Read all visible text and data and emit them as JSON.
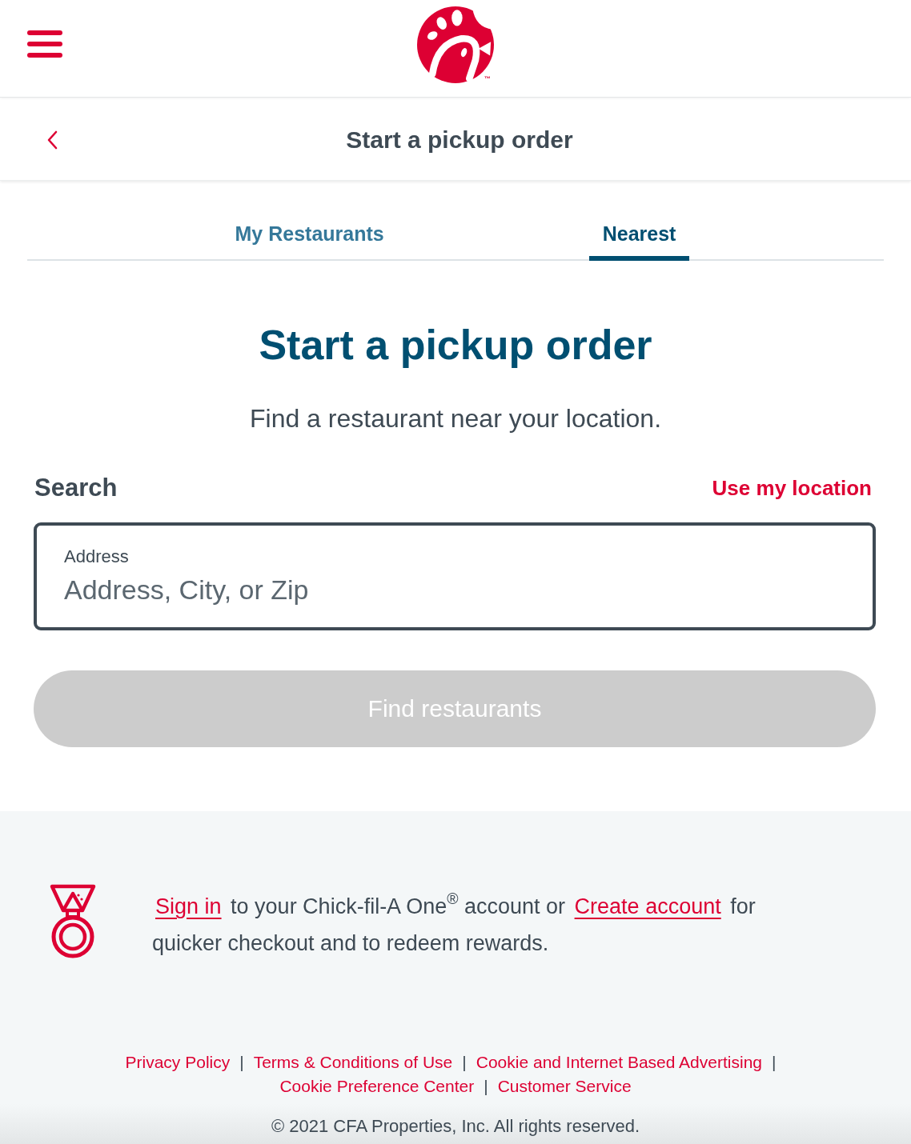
{
  "header": {
    "logo_mark": "™"
  },
  "subheader": {
    "title": "Start a pickup order"
  },
  "tabs": [
    {
      "label": "My Restaurants",
      "selected": false
    },
    {
      "label": "Nearest",
      "selected": true
    }
  ],
  "main": {
    "heading": "Start a pickup order",
    "subtitle": "Find a restaurant near your location.",
    "search_label": "Search",
    "location_link": "Use my location",
    "address_field": {
      "label": "Address",
      "placeholder": "Address, City, or Zip"
    },
    "find_button": {
      "label": "Find restaurants",
      "disabled": true
    }
  },
  "promo": {
    "parts": [
      {
        "kind": "link",
        "text": "Sign in"
      },
      {
        "kind": "text",
        "text": "to your Chick-fil-A One$^{®}$ account or"
      },
      {
        "kind": "link",
        "text": "Create account"
      },
      {
        "kind": "text",
        "text": "for quicker checkout and to redeem rewards."
      }
    ]
  },
  "footer": {
    "separator": "|",
    "link_rows": [
      [
        "Privacy Policy",
        "Terms & Conditions of Use",
        "Cookie and Internet Based Advertising"
      ],
      [
        "Cookie Preference Center",
        "Customer Service"
      ]
    ],
    "copyright": "© 2021 CFA Properties, Inc. All rights reserved."
  }
}
